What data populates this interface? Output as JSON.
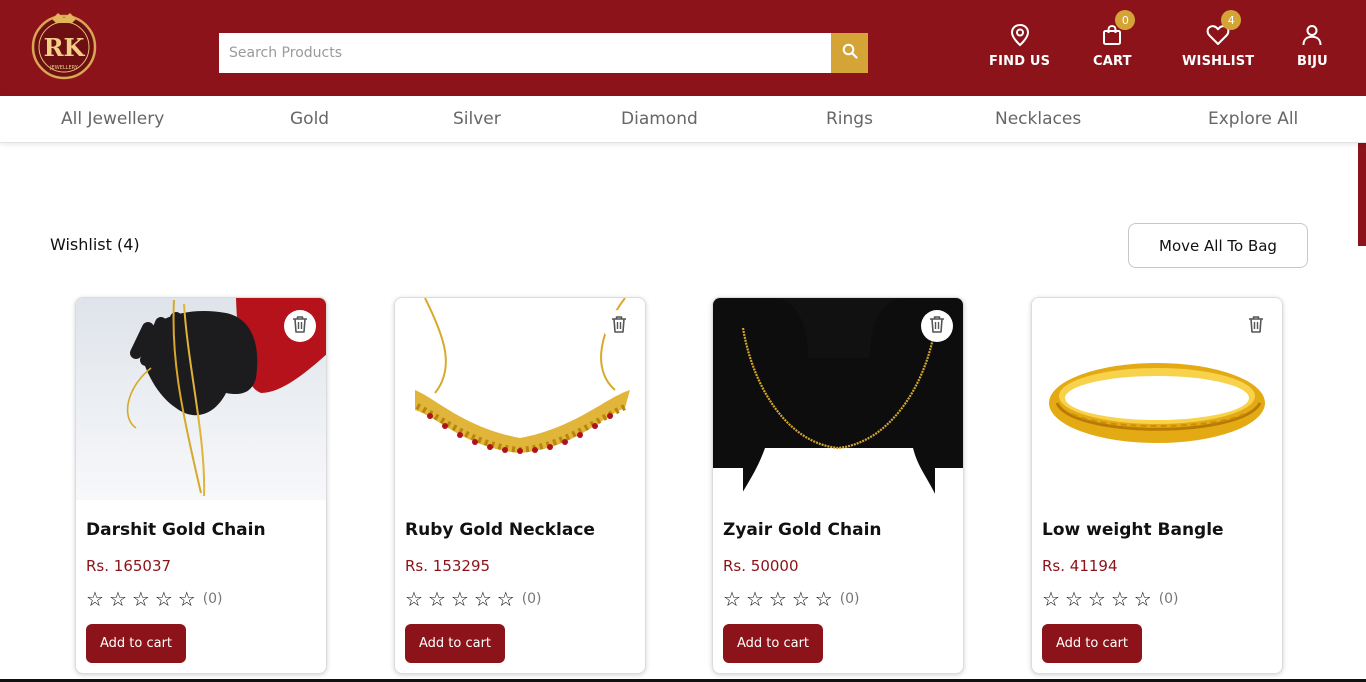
{
  "header": {
    "logo_text": "RK",
    "logo_subtext": "JEWELLERY",
    "search_placeholder": "Search Products",
    "find_us_label": "FIND US",
    "cart_label": "CART",
    "cart_count": "0",
    "wishlist_label": "WISHLIST",
    "wishlist_count": "4",
    "user_label": "BIJU",
    "brand_color": "#8b1319",
    "accent_color": "#d4a437"
  },
  "nav": {
    "items": [
      "All Jewellery",
      "Gold",
      "Silver",
      "Diamond",
      "Rings",
      "Necklaces",
      "Explore All"
    ]
  },
  "wishlist": {
    "title": "Wishlist (4)",
    "move_all_label": "Move All To Bag",
    "products": [
      {
        "name": "Darshit Gold Chain",
        "price": "Rs. 165037",
        "rating_count": "(0)",
        "add_label": "Add to cart",
        "image_icon": "gold-chain-on-hand"
      },
      {
        "name": "Ruby Gold Necklace",
        "price": "Rs. 153295",
        "rating_count": "(0)",
        "add_label": "Add to cart",
        "image_icon": "ruby-necklace"
      },
      {
        "name": "Zyair Gold Chain",
        "price": "Rs. 50000",
        "rating_count": "(0)",
        "add_label": "Add to cart",
        "image_icon": "gold-chain-on-bust"
      },
      {
        "name": "Low weight Bangle",
        "price": "Rs. 41194",
        "rating_count": "(0)",
        "add_label": "Add to cart",
        "image_icon": "gold-bangle"
      }
    ]
  }
}
